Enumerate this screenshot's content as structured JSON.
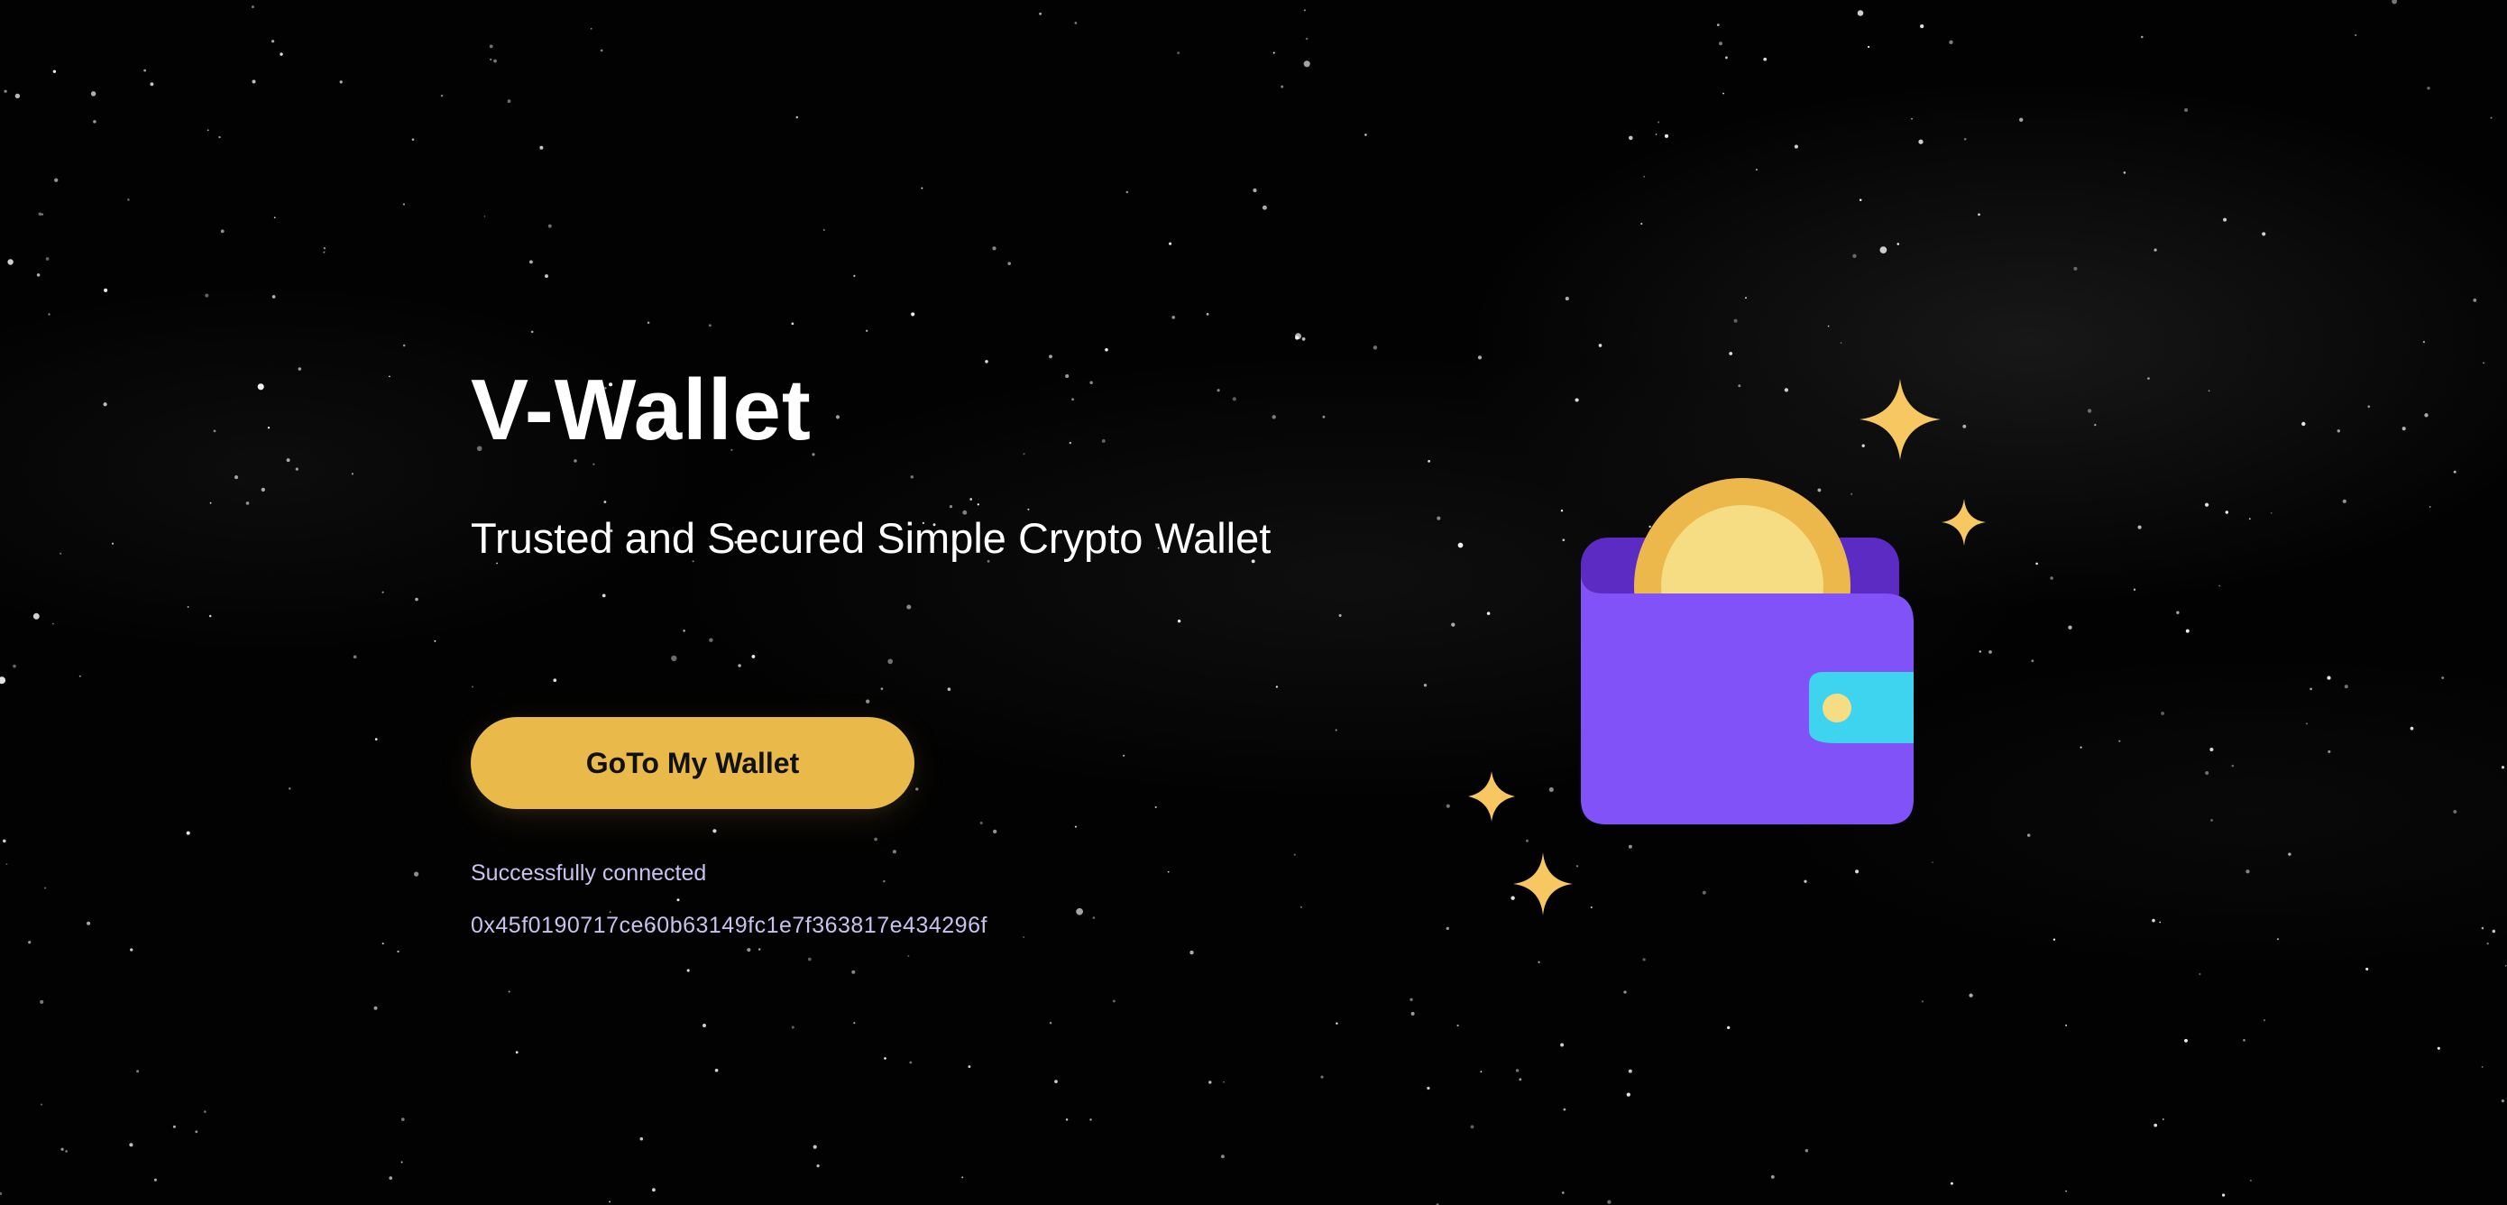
{
  "hero": {
    "title": "V-Wallet",
    "subtitle": "Trusted and Secured Simple Crypto Wallet",
    "cta_label": "GoTo My Wallet"
  },
  "connection": {
    "status": "Successfully connected",
    "address": "0x45f0190717ce60b63149fc1e7f363817e434296f"
  },
  "illustration": {
    "icon": "wallet-with-coin-illustration",
    "sparkles": "sparkle-icon"
  },
  "colors": {
    "background": "#000000",
    "accent": "#e9b94a",
    "wallet_body": "#8152f8",
    "wallet_back": "#5b2bc4",
    "coin_outer": "#ecb84c",
    "coin_inner": "#f6dc82",
    "clasp": "#3ed3ee",
    "status_text": "#c9c2ee"
  }
}
